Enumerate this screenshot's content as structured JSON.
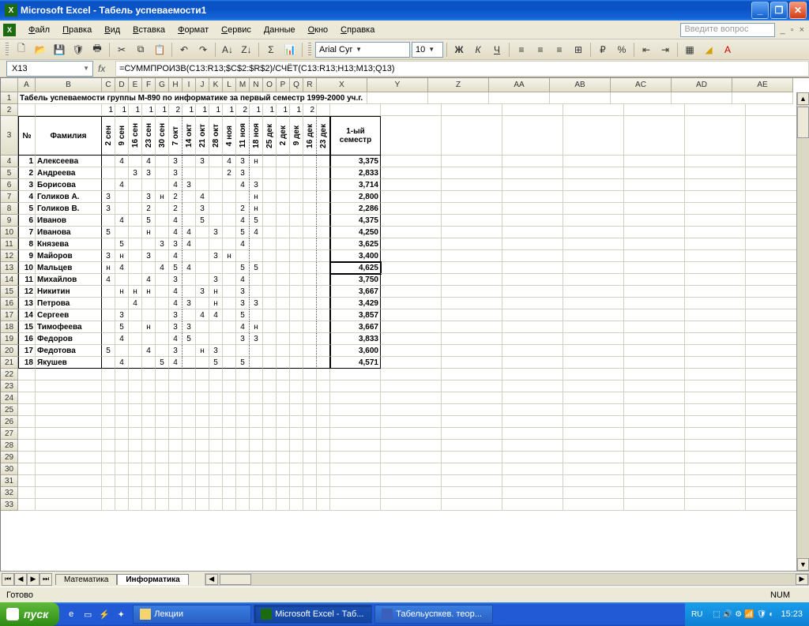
{
  "title": "Microsoft Excel - Табель успеваемости1",
  "menus": [
    "Файл",
    "Правка",
    "Вид",
    "Вставка",
    "Формат",
    "Сервис",
    "Данные",
    "Окно",
    "Справка"
  ],
  "questionPlaceholder": "Введите вопрос",
  "font": {
    "name": "Arial Cyr",
    "size": "10"
  },
  "namebox": "X13",
  "formula": "=СУММПРОИЗВ(C13:R13;$C$2:$R$2)/СЧЁТ(C13:R13;H13;M13;Q13)",
  "columns": [
    "A",
    "B",
    "C",
    "D",
    "E",
    "F",
    "G",
    "H",
    "I",
    "J",
    "K",
    "L",
    "M",
    "N",
    "O",
    "P",
    "Q",
    "R",
    "X",
    "Y",
    "Z",
    "AA",
    "AB",
    "AC",
    "AD",
    "AE"
  ],
  "colW": {
    "A": 22,
    "B": 84,
    "narrow": 17,
    "X": 64,
    "wide": 52
  },
  "row1_title": "Табель успеваемости группы М-890 по информатике за первый семестр 1999-2000 уч.г.",
  "weights": [
    "1",
    "1",
    "1",
    "1",
    "1",
    "2",
    "1",
    "1",
    "1",
    "1",
    "2",
    "1",
    "1",
    "1",
    "1",
    "2"
  ],
  "dates": [
    "2 сен",
    "9 сен",
    "16 сен",
    "23 сен",
    "30 сен",
    "7 окт",
    "14 окт",
    "21 окт",
    "28 окт",
    "4 ноя",
    "11 ноя",
    "18 ноя",
    "25 дек",
    "2 дек",
    "9 дек",
    "16 дек",
    "23 дек"
  ],
  "header": {
    "no": "№",
    "fam": "Фамилия",
    "sem": "1-ый семестр"
  },
  "rows": [
    {
      "n": "1",
      "f": "Алексеева",
      "d": [
        "",
        "4",
        "",
        "4",
        "",
        "3",
        "",
        "3",
        "",
        "4",
        "3",
        "н",
        "",
        "",
        "",
        "",
        ""
      ],
      "s": "3,375"
    },
    {
      "n": "2",
      "f": "Андреева",
      "d": [
        "",
        "",
        "3",
        "3",
        "",
        "3",
        "",
        "",
        "",
        "2",
        "3",
        "",
        "",
        "",
        "",
        "",
        ""
      ],
      "s": "2,833"
    },
    {
      "n": "3",
      "f": "Борисова",
      "d": [
        "",
        "4",
        "",
        "",
        "",
        "4",
        "3",
        "",
        "",
        "",
        "4",
        "3",
        "",
        "",
        "",
        "",
        ""
      ],
      "s": "3,714"
    },
    {
      "n": "4",
      "f": "Голиков А.",
      "d": [
        "3",
        "",
        "",
        "3",
        "н",
        "2",
        "",
        "4",
        "",
        "",
        "",
        "н",
        "",
        "",
        "",
        "",
        ""
      ],
      "s": "2,800"
    },
    {
      "n": "5",
      "f": "Голиков В.",
      "d": [
        "3",
        "",
        "",
        "2",
        "",
        "2",
        "",
        "3",
        "",
        "",
        "2",
        "н",
        "",
        "",
        "",
        "",
        ""
      ],
      "s": "2,286"
    },
    {
      "n": "6",
      "f": "Иванов",
      "d": [
        "",
        "4",
        "",
        "5",
        "",
        "4",
        "",
        "5",
        "",
        "",
        "4",
        "5",
        "",
        "",
        "",
        "",
        ""
      ],
      "s": "4,375"
    },
    {
      "n": "7",
      "f": "Иванова",
      "d": [
        "5",
        "",
        "",
        "н",
        "",
        "4",
        "4",
        "",
        "3",
        "",
        "5",
        "4",
        "",
        "",
        "",
        "",
        ""
      ],
      "s": "4,250"
    },
    {
      "n": "8",
      "f": "Князева",
      "d": [
        "",
        "5",
        "",
        "",
        "3",
        "3",
        "4",
        "",
        "",
        "",
        "4",
        "",
        "",
        "",
        "",
        "",
        ""
      ],
      "s": "3,625"
    },
    {
      "n": "9",
      "f": "Майоров",
      "d": [
        "3",
        "н",
        "",
        "3",
        "",
        "4",
        "",
        "",
        "3",
        "н",
        "",
        "",
        "",
        "",
        "",
        "",
        ""
      ],
      "s": "3,400"
    },
    {
      "n": "10",
      "f": "Мальцев",
      "d": [
        "н",
        "4",
        "",
        "",
        "4",
        "5",
        "4",
        "",
        "",
        "",
        "5",
        "5",
        "",
        "",
        "",
        "",
        ""
      ],
      "s": "4,625"
    },
    {
      "n": "11",
      "f": "Михайлов",
      "d": [
        "4",
        "",
        "",
        "4",
        "",
        "3",
        "",
        "",
        "3",
        "",
        "4",
        "",
        "",
        "",
        "",
        "",
        ""
      ],
      "s": "3,750"
    },
    {
      "n": "12",
      "f": "Никитин",
      "d": [
        "",
        "н",
        "н",
        "н",
        "",
        "4",
        "",
        "3",
        "н",
        "",
        "3",
        "",
        "",
        "",
        "",
        "",
        ""
      ],
      "s": "3,667"
    },
    {
      "n": "13",
      "f": "Петрова",
      "d": [
        "",
        "",
        "4",
        "",
        "",
        "4",
        "3",
        "",
        "н",
        "",
        "3",
        "3",
        "",
        "",
        "",
        "",
        ""
      ],
      "s": "3,429"
    },
    {
      "n": "14",
      "f": "Сергеев",
      "d": [
        "",
        "3",
        "",
        "",
        "",
        "3",
        "",
        "4",
        "4",
        "",
        "5",
        "",
        "",
        "",
        "",
        "",
        ""
      ],
      "s": "3,857"
    },
    {
      "n": "15",
      "f": "Тимофеева",
      "d": [
        "",
        "5",
        "",
        "н",
        "",
        "3",
        "3",
        "",
        "",
        "",
        "4",
        "н",
        "",
        "",
        "",
        "",
        ""
      ],
      "s": "3,667"
    },
    {
      "n": "16",
      "f": "Федоров",
      "d": [
        "",
        "4",
        "",
        "",
        "",
        "4",
        "5",
        "",
        "",
        "",
        "3",
        "3",
        "",
        "",
        "",
        "",
        ""
      ],
      "s": "3,833"
    },
    {
      "n": "17",
      "f": "Федотова",
      "d": [
        "5",
        "",
        "",
        "4",
        "",
        "3",
        "",
        "н",
        "3",
        "",
        "",
        "",
        "",
        "",
        "",
        "",
        ""
      ],
      "s": "3,600"
    },
    {
      "n": "18",
      "f": "Якушев",
      "d": [
        "",
        "4",
        "",
        "",
        "5",
        "4",
        "",
        "",
        "5",
        "",
        "5",
        "",
        "",
        "",
        "",
        "",
        ""
      ],
      "s": "4,571"
    }
  ],
  "emptyRows": [
    22,
    23,
    24,
    25,
    26,
    27,
    28,
    29,
    30,
    31,
    32,
    33
  ],
  "sheets": [
    "Математика",
    "Информатика"
  ],
  "activeSheet": 1,
  "status": "Готово",
  "statusNum": "NUM",
  "start": "пуск",
  "tasks": [
    {
      "label": "Лекции",
      "active": false,
      "color": "#f5d470"
    },
    {
      "label": "Microsoft Excel - Таб...",
      "active": true,
      "color": "#1d6b11"
    },
    {
      "label": "Табельуспкев. теор...",
      "active": false,
      "color": "#3b5fbb"
    }
  ],
  "lang": "RU",
  "clock": "15:23"
}
